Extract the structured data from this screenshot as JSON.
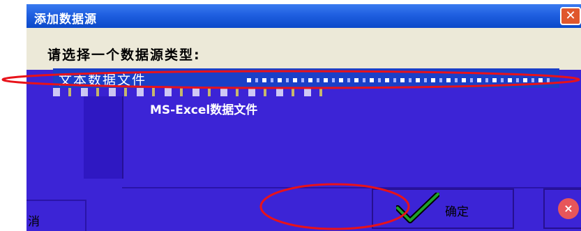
{
  "window": {
    "title": "添加数据源",
    "close_label": "✕"
  },
  "dialog": {
    "prompt": "请选择一个数据源类型:",
    "list_items": [
      {
        "label": "文本数据文件",
        "selected": true
      },
      {
        "label": "MS-Excel数据文件",
        "selected": false
      }
    ]
  },
  "buttons": {
    "ok_label": "确定",
    "cancel_label": "取消",
    "cancel_visible_label": "消",
    "cancel_icon": "×"
  },
  "icons": {
    "ok": "checkmark-icon",
    "cancel": "cancel-icon",
    "close": "close-icon"
  },
  "colors": {
    "titlebar": "#1f5fe0",
    "dialog_bg": "#3c24d6",
    "selection": "#1a3fc8",
    "annotation": "#e8121a"
  }
}
